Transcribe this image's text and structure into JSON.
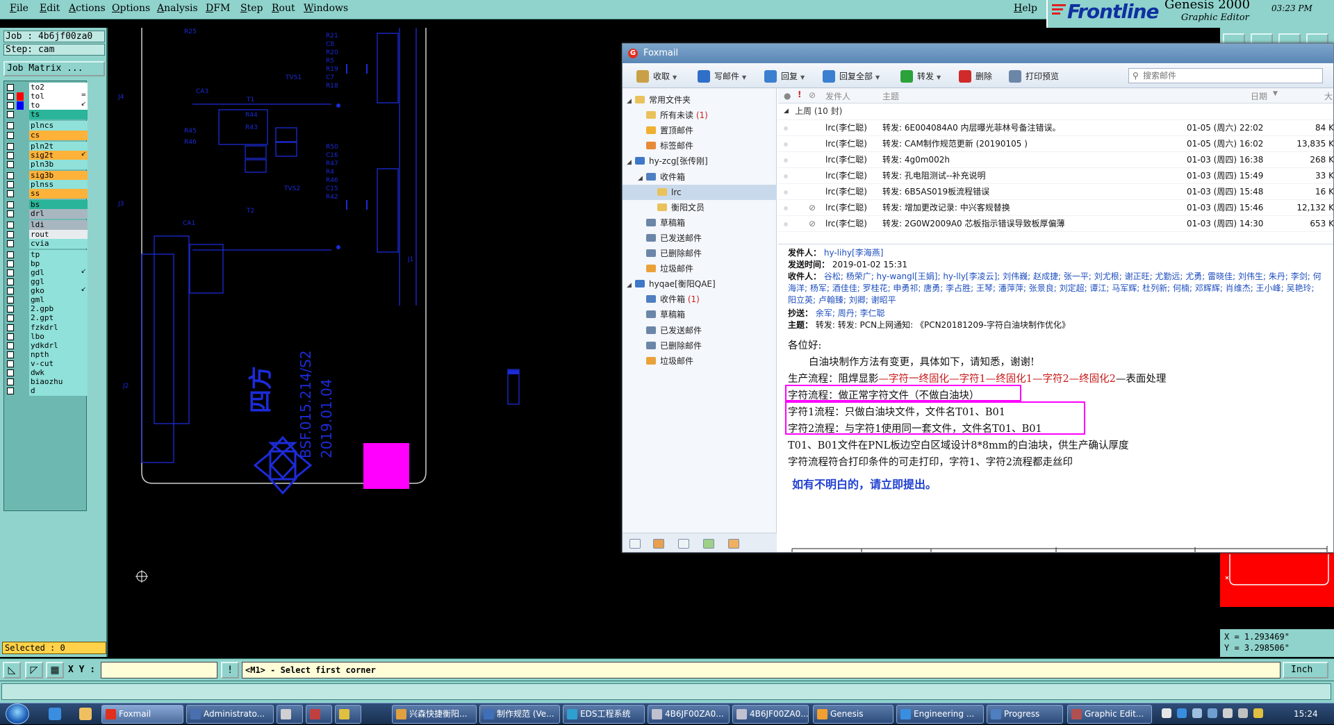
{
  "menubar": {
    "items": [
      "File",
      "Edit",
      "Actions",
      "Options",
      "Analysis",
      "DFM",
      "Step",
      "Rout",
      "Windows"
    ],
    "help": "Help"
  },
  "logo": {
    "brand": "Frontline",
    "product": "Genesis 2000",
    "subtitle": "Graphic Editor",
    "time": "03:23 PM"
  },
  "job": {
    "job_line": "Job : 4b6jf00za0",
    "step_line": "Step: cam",
    "matrix_label": "Job Matrix ..."
  },
  "layers": [
    {
      "name": "to2",
      "color": "#ffffff",
      "swatch": ""
    },
    {
      "name": "tol",
      "color": "#ffffff",
      "swatch": "#ff0000",
      "flag": "="
    },
    {
      "name": "to",
      "color": "#ffffff",
      "swatch": "#0000ff",
      "flag": "↙"
    },
    {
      "name": "ts",
      "color": "#2ab59a",
      "swatch": ""
    },
    {
      "name": "plncs",
      "color": "#8fe1d9",
      "swatch": ""
    },
    {
      "name": "cs",
      "color": "#ffb23a",
      "swatch": ""
    },
    {
      "name": "pln2t",
      "color": "#8fe1d9",
      "swatch": ""
    },
    {
      "name": "sig2t",
      "color": "#ffb23a",
      "swatch": "",
      "flag": "↙"
    },
    {
      "name": "pln3b",
      "color": "#8fe1d9",
      "swatch": ""
    },
    {
      "name": "sig3b",
      "color": "#ffb23a",
      "swatch": ""
    },
    {
      "name": "plnss",
      "color": "#8fe1d9",
      "swatch": ""
    },
    {
      "name": "ss",
      "color": "#ffb23a",
      "swatch": ""
    },
    {
      "name": "bs",
      "color": "#2ab59a",
      "swatch": ""
    },
    {
      "name": "drl",
      "color": "#a8b6c0",
      "swatch": ""
    },
    {
      "name": "ldi",
      "color": "#a8b6c0",
      "swatch": ""
    },
    {
      "name": "rout",
      "color": "#e8ecef",
      "swatch": ""
    },
    {
      "name": "cvia",
      "color": "#8fe1d9",
      "swatch": ""
    },
    {
      "name": "tp",
      "color": "#8fe1d9",
      "swatch": ""
    },
    {
      "name": "bp",
      "color": "#8fe1d9",
      "swatch": ""
    },
    {
      "name": "gdl",
      "color": "#8fe1d9",
      "swatch": "",
      "flag": "↙"
    },
    {
      "name": "ggl",
      "color": "#8fe1d9",
      "swatch": ""
    },
    {
      "name": "gko",
      "color": "#8fe1d9",
      "swatch": "",
      "flag": "↙"
    },
    {
      "name": "gml",
      "color": "#8fe1d9",
      "swatch": ""
    },
    {
      "name": "2.gpb",
      "color": "#8fe1d9",
      "swatch": ""
    },
    {
      "name": "2.gpt",
      "color": "#8fe1d9",
      "swatch": ""
    },
    {
      "name": "fzkdrl",
      "color": "#8fe1d9",
      "swatch": ""
    },
    {
      "name": "lbo",
      "color": "#8fe1d9",
      "swatch": ""
    },
    {
      "name": "ydkdrl",
      "color": "#8fe1d9",
      "swatch": ""
    },
    {
      "name": "npth",
      "color": "#8fe1d9",
      "swatch": ""
    },
    {
      "name": "v-cut",
      "color": "#8fe1d9",
      "swatch": ""
    },
    {
      "name": "dwk",
      "color": "#8fe1d9",
      "swatch": ""
    },
    {
      "name": "biaozhu",
      "color": "#8fe1d9",
      "swatch": ""
    },
    {
      "name": "d",
      "color": "#8fe1d9",
      "swatch": ""
    }
  ],
  "selected": "Selected : 0",
  "canvas": {
    "labels": [
      "R25",
      "R21",
      "C8",
      "R20",
      "R5",
      "R19",
      "C7",
      "R18",
      "TVS1",
      "CA3",
      "T1",
      "R44",
      "R43",
      "R45",
      "R46",
      "J4",
      "R50",
      "C16",
      "R47",
      "R4",
      "R46",
      "C15",
      "R42",
      "TVS2",
      "J3",
      "T2",
      "CA1",
      "J1",
      "J2"
    ],
    "brand_cn": "四方",
    "code_line1": "BSF.015.214/S2",
    "code_line2": "2019.01.04"
  },
  "coords": {
    "x": "X = 1.293469\"",
    "y": "Y = 3.298506\""
  },
  "status": {
    "xy_label": "X Y :",
    "xy_value": "",
    "prompt": "<M1> - Select first corner",
    "units": "Inch"
  },
  "foxmail": {
    "title": "Foxmail",
    "toolbar": [
      "收取",
      "写邮件",
      "回复",
      "回复全部",
      "转发",
      "删除",
      "打印预览"
    ],
    "search_placeholder": "搜索邮件",
    "tree": [
      {
        "label": "常用文件夹",
        "level": 0,
        "expander": "◢",
        "icon": "#e9c25c"
      },
      {
        "label": "所有未读",
        "level": 1,
        "count": "(1)",
        "icon": "#e9c25c"
      },
      {
        "label": "置顶邮件",
        "level": 1,
        "icon": "#f0b030"
      },
      {
        "label": "标签邮件",
        "level": 1,
        "icon": "#e78a3a"
      },
      {
        "label": "hy-zcg[张传刚]",
        "level": 0,
        "expander": "◢",
        "icon": "#3e78c8"
      },
      {
        "label": "收件箱",
        "level": 1,
        "expander": "◢",
        "icon": "#4f7fc0"
      },
      {
        "label": "lrc",
        "level": 2,
        "icon": "#e9c25c",
        "selected": true
      },
      {
        "label": "衡阳文员",
        "level": 2,
        "icon": "#e9c25c"
      },
      {
        "label": "草稿箱",
        "level": 1,
        "icon": "#6c86a8"
      },
      {
        "label": "已发送邮件",
        "level": 1,
        "icon": "#6c86a8"
      },
      {
        "label": "已删除邮件",
        "level": 1,
        "icon": "#6c86a8"
      },
      {
        "label": "垃圾邮件",
        "level": 1,
        "icon": "#e9a23a"
      },
      {
        "label": "hyqae[衡阳QAE]",
        "level": 0,
        "expander": "◢",
        "icon": "#3e78c8"
      },
      {
        "label": "收件箱",
        "level": 1,
        "count": "(1)",
        "icon": "#4f7fc0"
      },
      {
        "label": "草稿箱",
        "level": 1,
        "icon": "#6c86a8"
      },
      {
        "label": "已发送邮件",
        "level": 1,
        "icon": "#6c86a8"
      },
      {
        "label": "已删除邮件",
        "level": 1,
        "icon": "#6c86a8"
      },
      {
        "label": "垃圾邮件",
        "level": 1,
        "icon": "#e9a23a"
      }
    ],
    "list_header": {
      "sender": "发件人",
      "subject": "主题",
      "date": "日期",
      "size": "大"
    },
    "group_label": "上周 (10 封)",
    "messages": [
      {
        "from": "lrc(李仁聪)",
        "subject": "转发: 6E004084A0  内层曝光菲林号备注错误。",
        "date": "01-05 (周六) 22:02",
        "size": "84 K",
        "attach": false
      },
      {
        "from": "lrc(李仁聪)",
        "subject": "转发: CAM制作规范更新 (20190105 )",
        "date": "01-05 (周六) 16:02",
        "size": "13,835 K",
        "attach": false
      },
      {
        "from": "lrc(李仁聪)",
        "subject": "转发: 4g0m002h",
        "date": "01-03 (周四) 16:38",
        "size": "268 K",
        "attach": false
      },
      {
        "from": "lrc(李仁聪)",
        "subject": "转发: 孔电阻测试--补充说明",
        "date": "01-03 (周四) 15:49",
        "size": "33 K",
        "attach": false
      },
      {
        "from": "lrc(李仁聪)",
        "subject": "转发: 6B5AS019板流程错误",
        "date": "01-03 (周四) 15:48",
        "size": "16 K",
        "attach": false
      },
      {
        "from": "lrc(李仁聪)",
        "subject": "转发: 增加更改记录: 中兴客规替换",
        "date": "01-03 (周四) 15:46",
        "size": "12,132 K",
        "attach": true
      },
      {
        "from": "lrc(李仁聪)",
        "subject": "转发: 2G0W2009A0  芯板指示错误导致板厚偏薄",
        "date": "01-03 (周四) 14:30",
        "size": "653 K",
        "attach": true
      }
    ],
    "preview": {
      "from_label": "发件人：",
      "from": "hy-lihy[李海燕]",
      "time_label": "发送时间：",
      "time": "2019-01-02 15:31",
      "to_label": "收件人：",
      "to": "谷松; 杨荣广; hy-wangl[王娟]; hy-lly[李凌云]; 刘伟巍; 赵成捷; 张一平; 刘尤根; 谢正旺; 尤勤远; 尤勇; 雷晓佳; 刘伟生; 朱丹; 李剑; 何海洋; 杨军; 酒佳佳; 罗桂花; 申勇祁; 唐勇; 李占胜; 王琴; 潘萍萍; 张景良; 刘定超; 谭江; 马军辉; 杜列新; 何楠; 邓辉辉; 肖维杰; 王小峰; 吴艳玲; 阳立英; 卢翰臻; 刘卿; 谢昭平",
      "cc_label": "抄送：",
      "cc": "余军; 周丹; 李仁聪",
      "subject_label": "主题：",
      "subject": "转发: 转发: PCN上网通知: 《PCN20181209-字符白油块制作优化》",
      "greeting": "各位好:",
      "intro": "白油块制作方法有变更，具体如下，请知悉，谢谢!",
      "flow_prefix": "生产流程：阻焊显影",
      "flow_red": "—字符一终固化—字符1—终固化1—字符2—终固化2",
      "flow_suffix": "—表面处理",
      "line_char": "字符流程：做正常字符文件（不做白油块）",
      "line_char1": "字符1流程：只做白油块文件，文件名T01、B01",
      "line_char2": "字符2流程：与字符1使用同一套文件，文件名T01、B01",
      "line_t01": "T01、B01文件在PNL板边空白区域设计8*8mm的白油块，供生产确认厚度",
      "line_print": "字符流程符合打印条件的可走打印，字符1、字符2流程都走丝印",
      "closing": "如有不明白的，请立即提出。"
    }
  },
  "taskbar": {
    "items": [
      "Foxmail",
      "Administrato...",
      "",
      "",
      "",
      "兴森快捷衡阳...",
      "制作规范 (Ve...",
      "EDS工程系统",
      "4B6JF00ZA0...",
      "4B6JF00ZA0...",
      "Genesis",
      "Engineering ...",
      "Progress",
      "Graphic Edit..."
    ],
    "clock": "15:24"
  }
}
